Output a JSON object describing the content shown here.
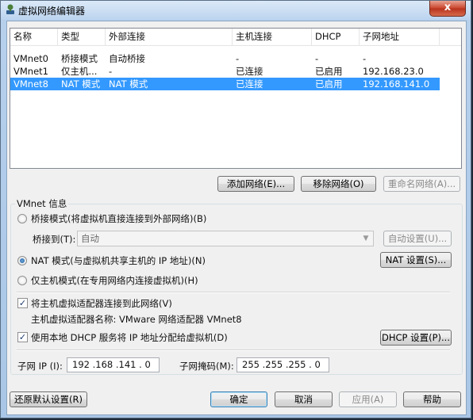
{
  "window": {
    "title": "虚拟网络编辑器",
    "close_glyph": "x",
    "app_icon": "network-editor-icon"
  },
  "table": {
    "headers": [
      "名称",
      "类型",
      "外部连接",
      "主机连接",
      "DHCP",
      "子网地址"
    ],
    "rows": [
      {
        "name": "VMnet0",
        "type": "桥接模式",
        "external": "自动桥接",
        "host": "-",
        "dhcp": "-",
        "subnet": "-",
        "selected": false
      },
      {
        "name": "VMnet1",
        "type": "仅主机...",
        "external": "-",
        "host": "已连接",
        "dhcp": "已启用",
        "subnet": "192.168.23.0",
        "selected": false
      },
      {
        "name": "VMnet8",
        "type": "NAT 模式",
        "external": "NAT 模式",
        "host": "已连接",
        "dhcp": "已启用",
        "subnet": "192.168.141.0",
        "selected": true
      }
    ]
  },
  "table_buttons": {
    "add": "添加网络(E)...",
    "remove": "移除网络(O)",
    "rename": "重命名网络(A)..."
  },
  "vmnet_info": {
    "label": "VMnet 信息",
    "bridged_label": "桥接模式(将虚拟机直接连接到外部网络)(B)",
    "bridged_to_label": "桥接到(T):",
    "bridged_to_value": "自动",
    "auto_settings": "自动设置(U)...",
    "nat_label": "NAT 模式(与虚拟机共享主机的 IP 地址)(N)",
    "nat_settings": "NAT 设置(S)...",
    "hostonly_label": "仅主机模式(在专用网络内连接虚拟机)(H)",
    "selected_mode": "nat",
    "connect_adapter_label": "将主机虚拟适配器连接到此网络(V)",
    "connect_adapter_checked": true,
    "adapter_name_label": "主机虚拟适配器名称: VMware 网络适配器 VMnet8",
    "dhcp_label": "使用本地 DHCP 服务将 IP 地址分配给虚拟机(D)",
    "dhcp_checked": true,
    "dhcp_settings": "DHCP 设置(P)...",
    "subnet_ip_label": "子网 IP (I):",
    "subnet_ip_value": "192 .168 .141 . 0",
    "subnet_mask_label": "子网掩码(M):",
    "subnet_mask_value": "255 .255 .255 . 0"
  },
  "footer": {
    "restore": "还原默认设置(R)",
    "ok": "确定",
    "cancel": "取消",
    "apply": "应用(A)",
    "help": "帮助"
  },
  "colors": {
    "selection": "#3399ff",
    "title_bg": "#bcd4ef",
    "close": "#c9452c"
  }
}
